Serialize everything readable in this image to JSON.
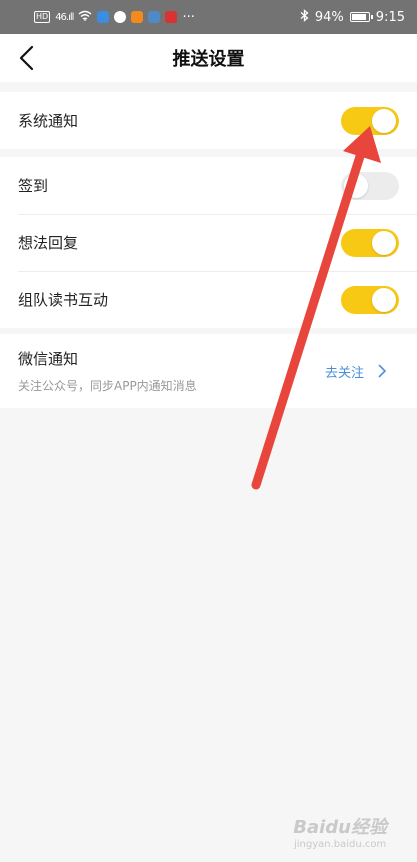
{
  "status_bar": {
    "network_badge": "HD",
    "signal": "46.ıll",
    "more": "···",
    "battery": "94%",
    "battery_level": 0.94,
    "time": "9:15"
  },
  "header": {
    "title": "推送设置",
    "back_icon": "chevron-left-icon"
  },
  "settings": {
    "system": {
      "label": "系统通知",
      "enabled": true
    },
    "items": [
      {
        "label": "签到",
        "enabled": false
      },
      {
        "label": "想法回复",
        "enabled": true
      },
      {
        "label": "组队读书互动",
        "enabled": true
      }
    ]
  },
  "wechat": {
    "title": "微信通知",
    "subtitle": "关注公众号，同步APP内通知消息",
    "action": "去关注"
  },
  "watermark": {
    "main": "Baidu经验",
    "sub": "jingyan.baidu.com"
  },
  "colors": {
    "toggle_on": "#f7c915",
    "toggle_off": "#ececec",
    "link": "#4a8fd9",
    "annotation_arrow": "#e8453c"
  }
}
